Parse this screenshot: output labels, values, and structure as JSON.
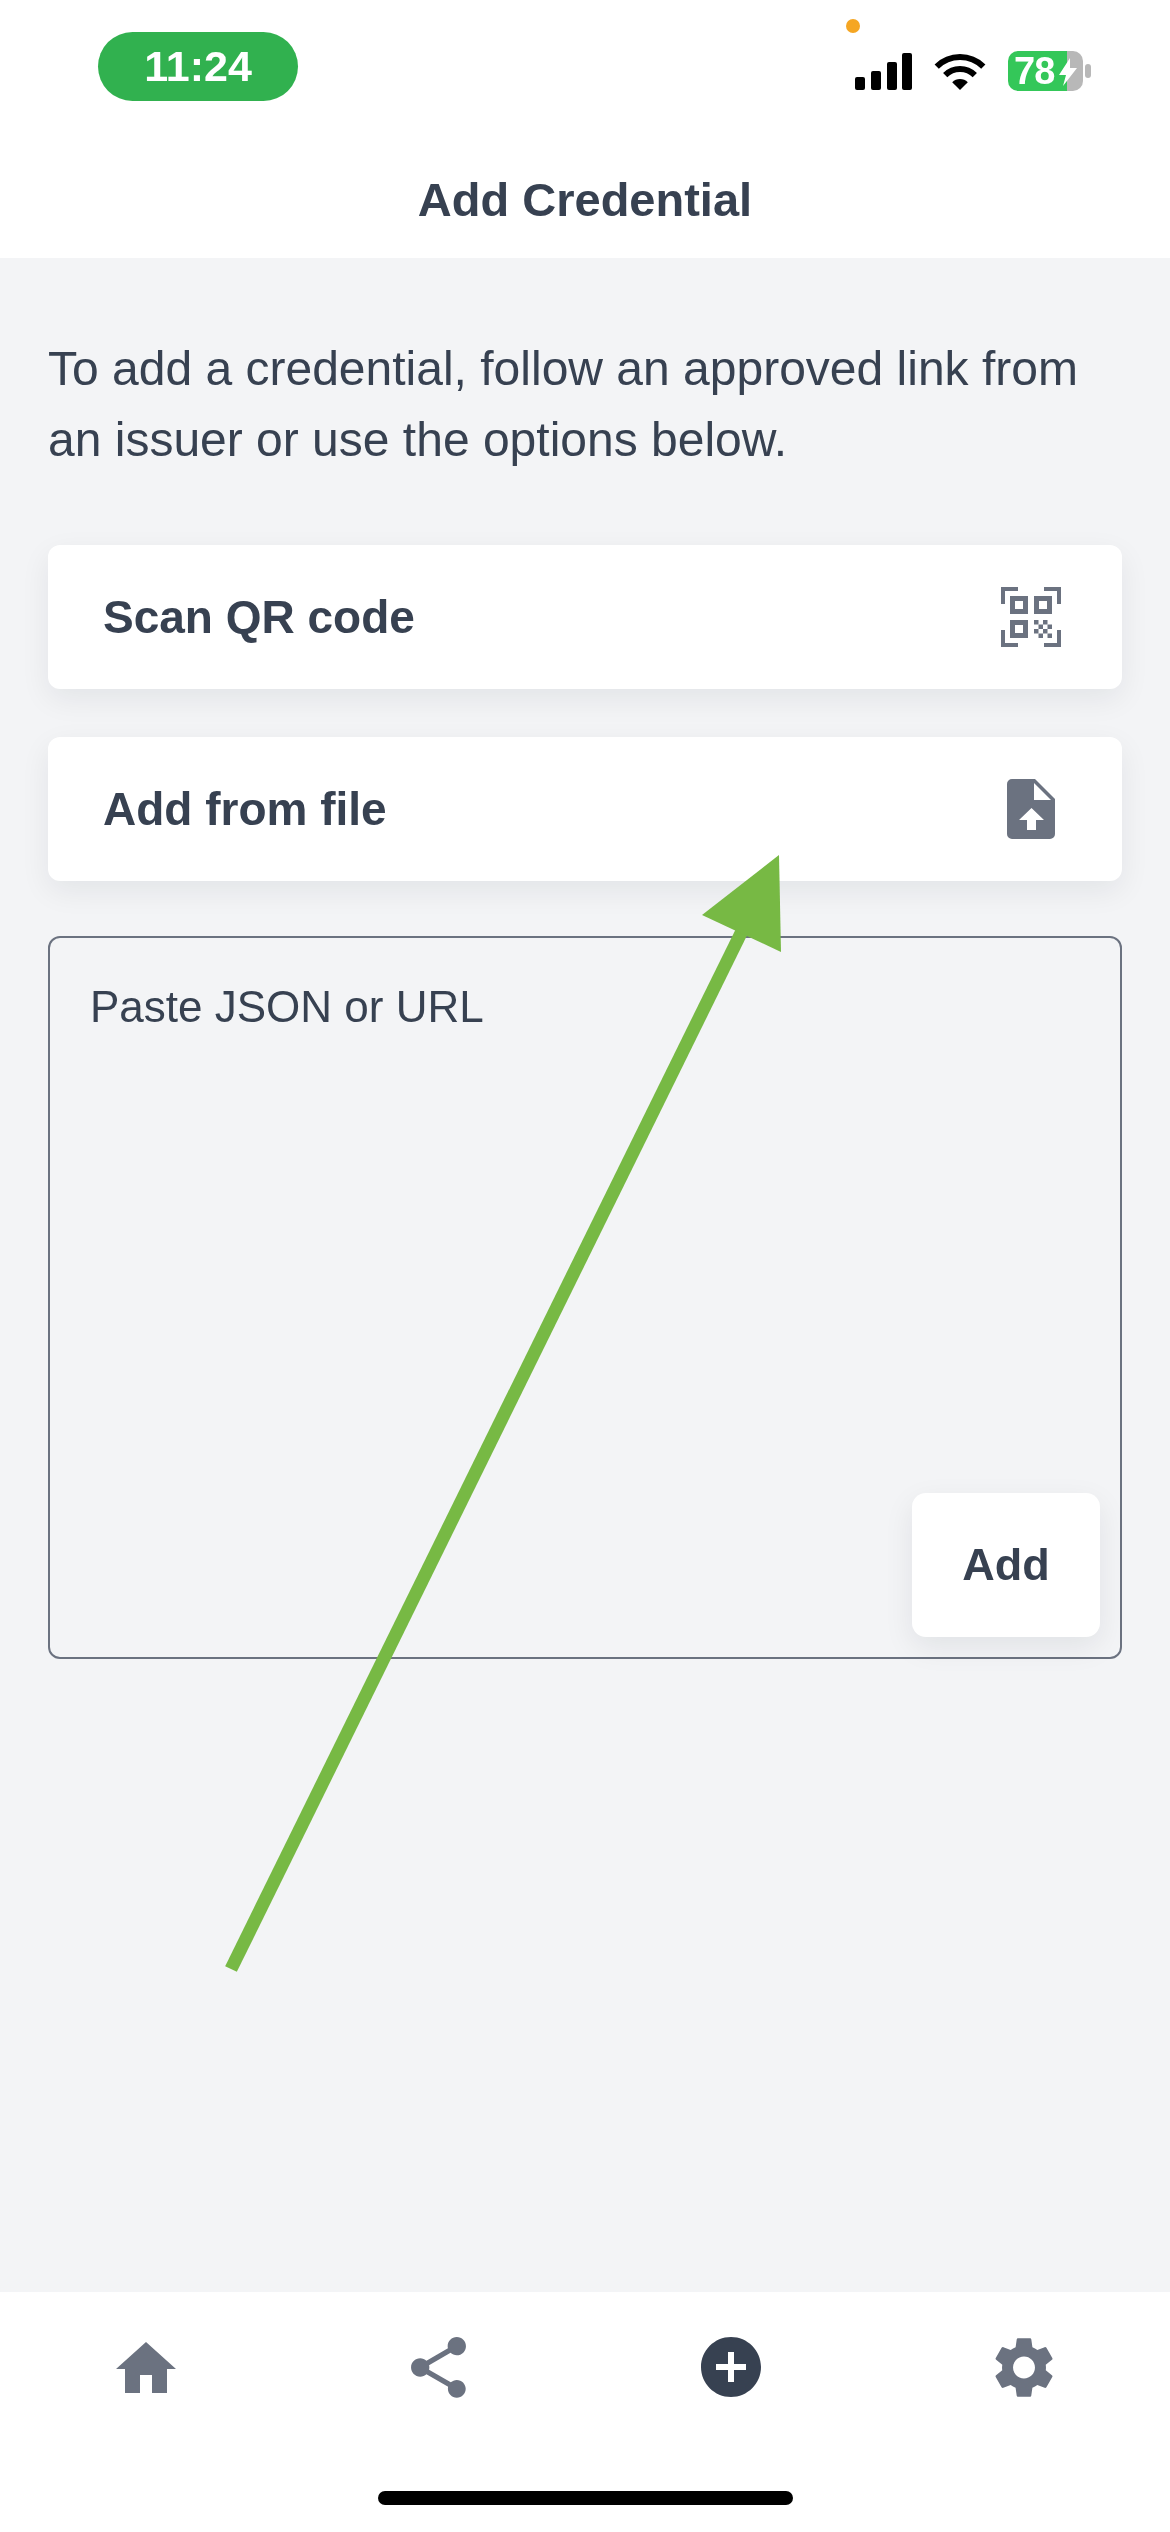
{
  "status_bar": {
    "time": "11:24",
    "battery": "78"
  },
  "header": {
    "title": "Add Credential"
  },
  "intro": "To add a credential, follow an approved link from an issuer or use the options below.",
  "options": [
    {
      "kind": "qr",
      "label": "Scan QR code"
    },
    {
      "kind": "file",
      "label": "Add from file"
    }
  ],
  "input": {
    "placeholder": "Paste JSON or URL",
    "button": "Add"
  },
  "annotations": [
    {
      "kind": "arrow"
    }
  ],
  "tab_bar": [
    {
      "kind": "home",
      "selected": false
    },
    {
      "kind": "share",
      "selected": false
    },
    {
      "kind": "add",
      "selected": true
    },
    {
      "kind": "settings",
      "selected": false
    }
  ]
}
